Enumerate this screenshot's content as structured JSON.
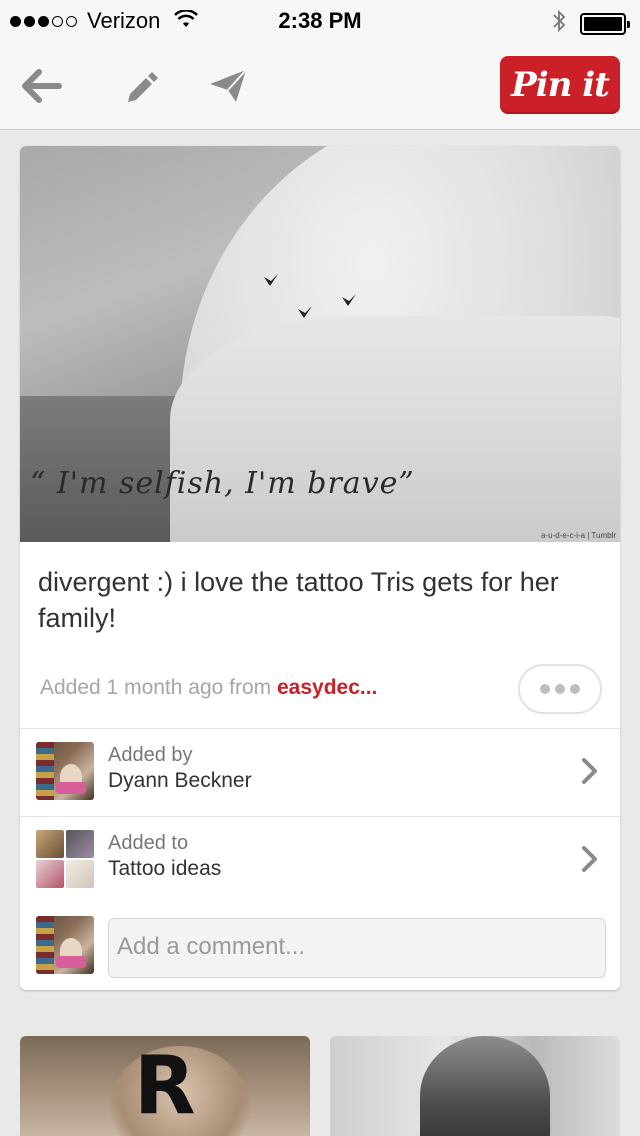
{
  "status_bar": {
    "carrier": "Verizon",
    "time": "2:38 PM",
    "signal_bars_filled": 3,
    "signal_bars_total": 5
  },
  "toolbar": {
    "pin_it_label": "Pin it",
    "icons": [
      "back-arrow-icon",
      "pencil-icon",
      "send-icon"
    ]
  },
  "pin": {
    "image_quote": "“ I'm selfish, I'm brave”",
    "image_watermark": "a-u-d-e-c-i-a | Tumblr",
    "description": "divergent :) i love the tattoo Tris gets for her family!",
    "added_prefix": "Added 1 month ago from ",
    "source": "easydec...",
    "added_by_caption": "Added by",
    "added_by_name": "Dyann Beckner",
    "added_to_caption": "Added to",
    "added_to_board": "Tattoo ideas",
    "comment_placeholder": "Add a comment..."
  },
  "grid_pins": [
    {
      "letter": "R"
    },
    {}
  ],
  "colors": {
    "accent": "#cb2027",
    "background": "#e9e9e9",
    "card": "#ffffff"
  }
}
